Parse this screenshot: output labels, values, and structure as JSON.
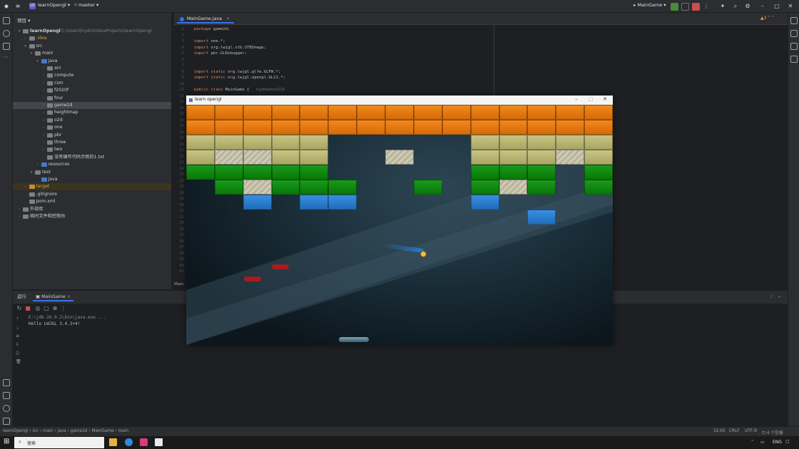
{
  "titlebar": {
    "project_badge": "LO",
    "project_name": "learnOpengl",
    "branch": "master",
    "run_config": "MainGame"
  },
  "project_panel": {
    "title": "项目",
    "tree": [
      {
        "label": "learnOpengl",
        "extra": "C:\\Users\\hydris\\IdeaProjects\\learnOpengl",
        "depth": 0,
        "arrow": "▾",
        "bold": true
      },
      {
        "label": ".idea",
        "depth": 1,
        "arrow": "›"
      },
      {
        "label": "src",
        "depth": 1,
        "arrow": "▾"
      },
      {
        "label": "main",
        "depth": 2,
        "arrow": "▾"
      },
      {
        "label": "java",
        "depth": 3,
        "arrow": "▾"
      },
      {
        "label": "ani",
        "depth": 4,
        "arrow": "›"
      },
      {
        "label": "compute",
        "depth": 4,
        "arrow": "›"
      },
      {
        "label": "csm",
        "depth": 4,
        "arrow": "›"
      },
      {
        "label": "f2020f",
        "depth": 4,
        "arrow": "›"
      },
      {
        "label": "four",
        "depth": 4,
        "arrow": "›"
      },
      {
        "label": "game2d",
        "depth": 4,
        "arrow": "›",
        "selected": true
      },
      {
        "label": "heightmap",
        "depth": 4,
        "arrow": "›"
      },
      {
        "label": "o2d",
        "depth": 4,
        "arrow": "›"
      },
      {
        "label": "one",
        "depth": 4,
        "arrow": "›"
      },
      {
        "label": "pbr",
        "depth": 4,
        "arrow": "›"
      },
      {
        "label": "three",
        "depth": 4,
        "arrow": "›"
      },
      {
        "label": "two",
        "depth": 4,
        "arrow": "›"
      },
      {
        "label": "没有编写代码示例的1.txt",
        "depth": 4,
        "arrow": ""
      },
      {
        "label": "resources",
        "depth": 3,
        "arrow": "›"
      },
      {
        "label": "test",
        "depth": 2,
        "arrow": "▾"
      },
      {
        "label": "java",
        "depth": 3,
        "arrow": ""
      },
      {
        "label": "target",
        "depth": 1,
        "arrow": "›",
        "target": true
      },
      {
        "label": ".gitignore",
        "depth": 1,
        "arrow": ""
      },
      {
        "label": "pom.xml",
        "depth": 1,
        "arrow": ""
      },
      {
        "label": "外部库",
        "depth": 0,
        "arrow": "›"
      },
      {
        "label": "临时文件和控制台",
        "depth": 0,
        "arrow": "›"
      }
    ]
  },
  "editor": {
    "tab": "MainGame.java",
    "warnings": "3",
    "author_hint": "mydreamo2018",
    "lines": [
      {
        "n": "1",
        "code": "package game2d;"
      },
      {
        "n": "2",
        "code": ""
      },
      {
        "n": "3",
        "code": "import one.*;"
      },
      {
        "n": "4",
        "code": "import org.lwjgl.stb.STBImage;"
      },
      {
        "n": "5",
        "code": "import pbr.GLDebugger;"
      },
      {
        "n": "6",
        "code": ""
      },
      {
        "n": "7",
        "code": ""
      },
      {
        "n": "8",
        "code": "import static org.lwjgl.glfw.GLFW.*;"
      },
      {
        "n": "9",
        "code": "import static org.lwjgl.opengl.GL11.*;"
      },
      {
        "n": "10",
        "code": ""
      },
      {
        "n": "11",
        "code": "public class MainGame {"
      }
    ],
    "hidden_line_numbers": [
      "12",
      "13",
      "14",
      "15",
      "16",
      "17",
      "18",
      "19",
      "20",
      "21",
      "22",
      "23",
      "24",
      "25",
      "26",
      "27",
      "28",
      "29",
      "30",
      "31",
      "32",
      "33",
      "34",
      "35",
      "36",
      "37",
      "38",
      "39",
      "40",
      "41"
    ],
    "breadcrumb_partial": "Main"
  },
  "run_panel": {
    "title": "运行",
    "tab": "MainGame",
    "console": [
      "E:\\jdk-26.0.2\\bin\\java.exe ...",
      "Hello LWJGL 3.4.3+4!"
    ]
  },
  "game_window": {
    "title": "learn opengl",
    "brick_colors": {
      "orange": "#e87a12",
      "khaki": "#bcb973",
      "green": "#119011",
      "blue": "#2a7fd0",
      "solid": "#c8c3ab"
    }
  },
  "statusbar": {
    "breadcrumbs": [
      "learnOpengl",
      "src",
      "main",
      "java",
      "game2d",
      "MainGame",
      "main"
    ],
    "position": "32:65",
    "line_sep": "CRLF",
    "encoding": "UTF-8",
    "indent": "4 个空格"
  },
  "taskbar": {
    "search_placeholder": "搜索",
    "lang": "ENG"
  }
}
